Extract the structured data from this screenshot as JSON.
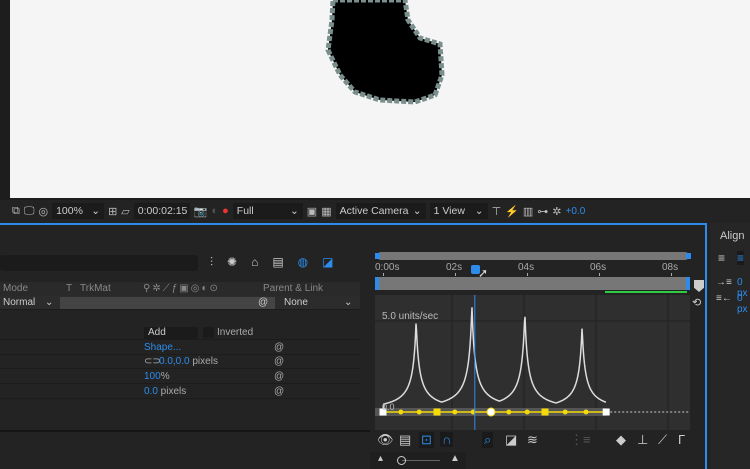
{
  "viewer": {
    "zoom": "100%",
    "timecode": "0:00:02:15",
    "resolution": "Full",
    "camera": "Active Camera",
    "views": "1 View",
    "exposure": "+0.0"
  },
  "timeline": {
    "headers": {
      "mode": "Mode",
      "t": "T",
      "trkmat": "TrkMat",
      "parent": "Parent & Link"
    },
    "layer": {
      "mode": "Normal",
      "parent": "None"
    },
    "mask": {
      "mode": "Add",
      "inverted": "Inverted",
      "shape": "Shape...",
      "feather": "0.0,0.0",
      "feather_unit": " pixels",
      "opacity": "100",
      "opacity_unit": "%",
      "expansion": "0.0",
      "expansion_unit": " pixels"
    },
    "ruler": [
      "0:00s",
      "02s",
      "04s",
      "06s",
      "08s"
    ],
    "graph": {
      "top_label": "5.0 units/sec",
      "zero_label": "0.0",
      "peaks": [
        {
          "t": 0.92,
          "v": 5.05
        },
        {
          "t": 2.47,
          "v": 5.9
        },
        {
          "t": 3.94,
          "v": 5.5
        },
        {
          "t": 5.53,
          "v": 4.7
        }
      ],
      "keyframes": [
        0,
        1.5,
        3.0,
        4.5,
        6.2
      ],
      "playhead": 2.55,
      "accent": "#f5d90a"
    }
  },
  "align": {
    "title": "Align",
    "v1": "0 px",
    "v2": "0 px"
  },
  "colors": {
    "accent": "#2d8ceb"
  }
}
